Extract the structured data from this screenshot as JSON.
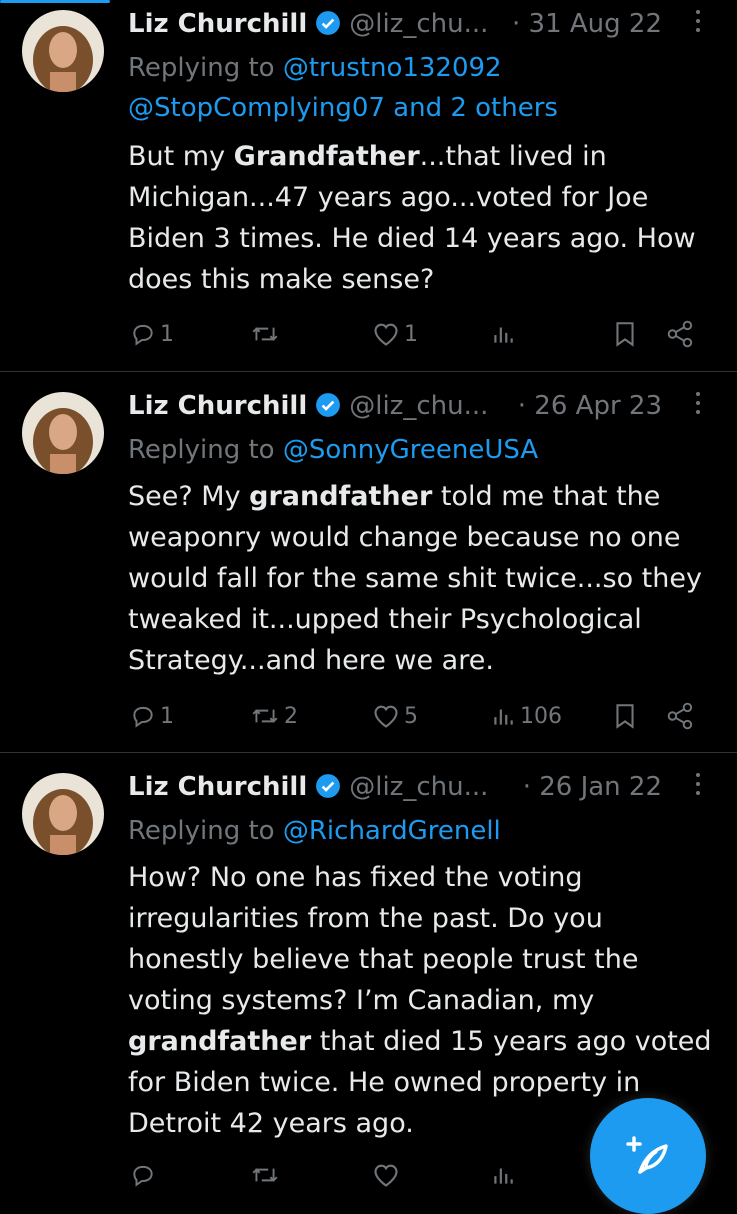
{
  "tweets": [
    {
      "name": "Liz Churchill",
      "handle": "@liz_chu...",
      "date": "· 31 Aug 22",
      "replying_prefix": "Replying to ",
      "replying_to": "@trustno132092",
      "replying_to_2": "@StopComplying07 and 2 others",
      "text_pre": "But my ",
      "text_bold": "Grandfather",
      "text_post": "...that lived in Michigan...47 years ago...voted for Joe Biden 3 times. He died 14 years ago. How does this make sense?",
      "replies": "1",
      "retweets": "",
      "likes": "1",
      "views": ""
    },
    {
      "name": "Liz Churchill",
      "handle": "@liz_chu...",
      "date": "· 26 Apr 23",
      "replying_prefix": "Replying to ",
      "replying_to": "@SonnyGreeneUSA",
      "text_pre": "See? My ",
      "text_bold": "grandfather",
      "text_post": " told me that the weaponry would change because no one would fall for the same shit twice...so they tweaked it...upped their Psychological Strategy...and here we are.",
      "replies": "1",
      "retweets": "2",
      "likes": "5",
      "views": "106"
    },
    {
      "name": "Liz Churchill",
      "handle": "@liz_chu...",
      "date": "· 26 Jan 22",
      "replying_prefix": "Replying to ",
      "replying_to": "@RichardGrenell",
      "text_pre": "How? No one has fixed the voting irregularities from the past. Do you honestly believe that people trust the voting systems? I’m Canadian, my ",
      "text_bold": "grandfather",
      "text_post": " that died 15 years ago voted for Biden twice. He owned property in Detroit 42 years ago.",
      "replies": "",
      "retweets": "",
      "likes": "",
      "views": ""
    }
  ],
  "colors": {
    "accent": "#1d9bf0",
    "muted": "#71767b",
    "text": "#e7e9ea",
    "background": "#000000"
  },
  "icons": {
    "reply": "reply-icon",
    "retweet": "retweet-icon",
    "like": "heart-icon",
    "views": "views-icon",
    "bookmark": "bookmark-icon",
    "share": "share-icon",
    "compose": "compose-feather-icon",
    "verified": "verified-badge-icon",
    "more": "more-dots-icon"
  }
}
